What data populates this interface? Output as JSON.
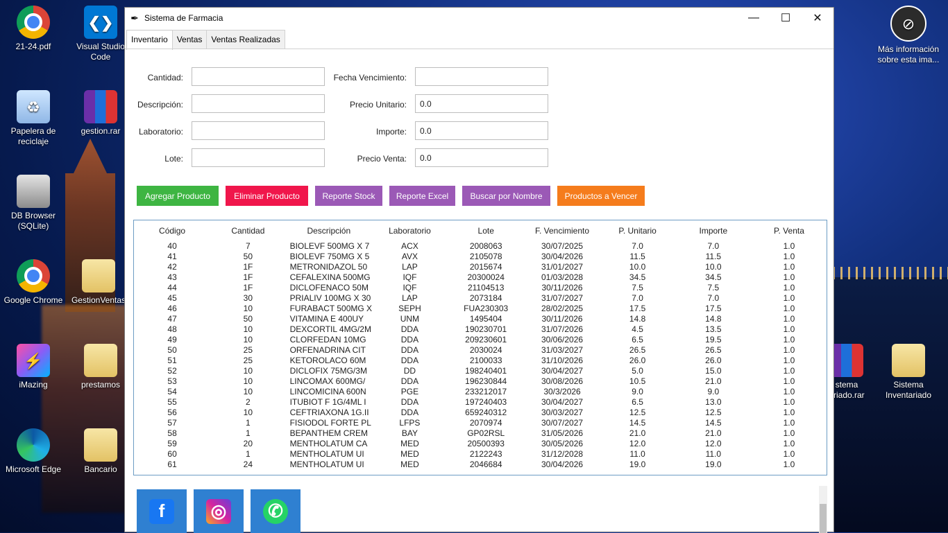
{
  "desktop": {
    "icons": [
      {
        "label": "21-24.pdf",
        "icon": "chrome-icon"
      },
      {
        "label": "Visual Studio Code",
        "icon": "vscode-icon"
      },
      {
        "label": "Papelera de reciclaje",
        "icon": "recycle-bin-icon"
      },
      {
        "label": "gestion.rar",
        "icon": "winrar-icon"
      },
      {
        "label": "DB Browser (SQLite)",
        "icon": "database-icon"
      },
      {
        "label": "Google Chrome",
        "icon": "chrome-icon"
      },
      {
        "label": "GestionVentas",
        "icon": "folder-icon"
      },
      {
        "label": "iMazing",
        "icon": "imazing-icon"
      },
      {
        "label": "prestamos",
        "icon": "folder-icon"
      },
      {
        "label": "Microsoft Edge",
        "icon": "edge-icon"
      },
      {
        "label": "Bancario",
        "icon": "folder-icon"
      },
      {
        "label": "Más información sobre esta ima...",
        "icon": "info-icon"
      },
      {
        "label": "Sistema Inventariado",
        "icon": "folder-icon"
      },
      {
        "label": "stema ariado.rar",
        "icon": "winrar-icon"
      }
    ]
  },
  "window": {
    "title": "Sistema de Farmacia",
    "controls": {
      "minimize": "—",
      "maximize": "☐",
      "close": "✕"
    }
  },
  "tabs": [
    {
      "label": "Inventario",
      "active": true
    },
    {
      "label": "Ventas",
      "active": false
    },
    {
      "label": "Ventas Realizadas",
      "active": false
    }
  ],
  "form": {
    "cantidad": {
      "label": "Cantidad:",
      "value": ""
    },
    "descripcion": {
      "label": "Descripción:",
      "value": ""
    },
    "laboratorio": {
      "label": "Laboratorio:",
      "value": ""
    },
    "lote": {
      "label": "Lote:",
      "value": ""
    },
    "fecha_vencimiento": {
      "label": "Fecha Vencimiento:",
      "value": ""
    },
    "precio_unitario": {
      "label": "Precio Unitario:",
      "value": "0.0"
    },
    "importe": {
      "label": "Importe:",
      "value": "0.0"
    },
    "precio_venta": {
      "label": "Precio Venta:",
      "value": "0.0"
    }
  },
  "buttons": {
    "agregar": {
      "label": "Agregar Producto",
      "color": "#3eb542"
    },
    "eliminar": {
      "label": "Eliminar Producto",
      "color": "#f0164b"
    },
    "reporte_stock": {
      "label": "Reporte Stock",
      "color": "#9b59b6"
    },
    "reporte_excel": {
      "label": "Reporte Excel",
      "color": "#9b59b6"
    },
    "buscar": {
      "label": "Buscar por Nombre",
      "color": "#9b59b6"
    },
    "vencer": {
      "label": "Productos a Vencer",
      "color": "#f57c1c"
    }
  },
  "table": {
    "columns": [
      "Código",
      "Cantidad",
      "Descripción",
      "Laboratorio",
      "Lote",
      "F. Vencimiento",
      "P. Unitario",
      "Importe",
      "P. Venta"
    ],
    "rows": [
      [
        "40",
        "7",
        "BIOLEVF 500MG X 7",
        "ACX",
        "2008063",
        "30/07/2025",
        "7.0",
        "7.0",
        "1.0"
      ],
      [
        "41",
        "50",
        "BIOLEVF 750MG X 5",
        "AVX",
        "2105078",
        "30/04/2026",
        "11.5",
        "11.5",
        "1.0"
      ],
      [
        "42",
        "1F",
        "METRONIDAZOL 50",
        "LAP",
        "2015674",
        "31/01/2027",
        "10.0",
        "10.0",
        "1.0"
      ],
      [
        "43",
        "1F",
        "CEFALEXINA 500MG",
        "IQF",
        "20300024",
        "01/03/2028",
        "34.5",
        "34.5",
        "1.0"
      ],
      [
        "44",
        "1F",
        "DICLOFENACO 50M",
        "IQF",
        "21104513",
        "30/11/2026",
        "7.5",
        "7.5",
        "1.0"
      ],
      [
        "45",
        "30",
        "PRIALIV 100MG X 30",
        "LAP",
        "2073184",
        "31/07/2027",
        "7.0",
        "7.0",
        "1.0"
      ],
      [
        "46",
        "10",
        "FURABACT 500MG X",
        "SEPH",
        "FUA230303",
        "28/02/2025",
        "17.5",
        "17.5",
        "1.0"
      ],
      [
        "47",
        "50",
        "VITAMINA E 400UY",
        "UNM",
        "1495404",
        "30/11/2026",
        "14.8",
        "14.8",
        "1.0"
      ],
      [
        "48",
        "10",
        "DEXCORTIL 4MG/2M",
        "DDA",
        "190230701",
        "31/07/2026",
        "4.5",
        "13.5",
        "1.0"
      ],
      [
        "49",
        "10",
        "CLORFEDAN 10MG",
        "DDA",
        "209230601",
        "30/06/2026",
        "6.5",
        "19.5",
        "1.0"
      ],
      [
        "50",
        "25",
        "ORFENADRINA CIT",
        "DDA",
        "2030024",
        "31/03/2027",
        "26.5",
        "26.5",
        "1.0"
      ],
      [
        "51",
        "25",
        "KETOROLACO 60M",
        "DDA",
        "2100033",
        "31/10/2026",
        "26.0",
        "26.0",
        "1.0"
      ],
      [
        "52",
        "10",
        "DICLOFIX 75MG/3M",
        "DD",
        "198240401",
        "30/04/2027",
        "5.0",
        "15.0",
        "1.0"
      ],
      [
        "53",
        "10",
        "LINCOMAX 600MG/",
        "DDA",
        "196230844",
        "30/08/2026",
        "10.5",
        "21.0",
        "1.0"
      ],
      [
        "54",
        "10",
        "LINCOMICINA 600N",
        "PGE",
        "233212017",
        "30/3/2026",
        "9.0",
        "9.0",
        "1.0"
      ],
      [
        "55",
        "2",
        "ITUBIOT F 1G/4ML I",
        "DDA",
        "197240403",
        "30/04/2027",
        "6.5",
        "13.0",
        "1.0"
      ],
      [
        "56",
        "10",
        "CEFTRIAXONA 1G.II",
        "DDA",
        "659240312",
        "30/03/2027",
        "12.5",
        "12.5",
        "1.0"
      ],
      [
        "57",
        "1",
        "FISIODOL FORTE PL",
        "LFPS",
        "2070974",
        "30/07/2027",
        "14.5",
        "14.5",
        "1.0"
      ],
      [
        "58",
        "1",
        "BEPANTHEM CREM",
        "BAY",
        "GP02RSL",
        "31/05/2026",
        "21.0",
        "21.0",
        "1.0"
      ],
      [
        "59",
        "20",
        "MENTHOLATUM CA",
        "MED",
        "20500393",
        "30/05/2026",
        "12.0",
        "12.0",
        "1.0"
      ],
      [
        "60",
        "1",
        "MENTHOLATUM UI",
        "MED",
        "2122243",
        "31/12/2028",
        "11.0",
        "11.0",
        "1.0"
      ],
      [
        "61",
        "24",
        "MENTHOLATUM UI",
        "MED",
        "2046684",
        "30/04/2026",
        "19.0",
        "19.0",
        "1.0"
      ]
    ]
  },
  "social": [
    {
      "icon": "facebook-icon",
      "glyph": "f",
      "color": "#1877f2"
    },
    {
      "icon": "instagram-icon",
      "glyph": "◎",
      "color": "#d6249f"
    },
    {
      "icon": "whatsapp-icon",
      "glyph": "✆",
      "color": "#25d366"
    }
  ]
}
